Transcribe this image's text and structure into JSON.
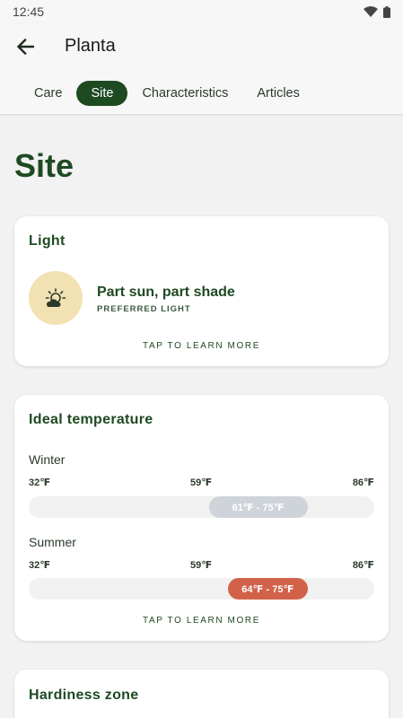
{
  "status_bar": {
    "time": "12:45"
  },
  "app_bar": {
    "title": "Planta"
  },
  "tabs": [
    {
      "label": "Care",
      "active": false
    },
    {
      "label": "Site",
      "active": true
    },
    {
      "label": "Characteristics",
      "active": false
    },
    {
      "label": "Articles",
      "active": false
    }
  ],
  "page": {
    "title": "Site"
  },
  "light_card": {
    "title": "Light",
    "value": "Part sun, part shade",
    "caption": "PREFERRED LIGHT",
    "icon": "sun-cloud-icon",
    "learn_more": "TAP TO LEARN MORE"
  },
  "temperature_card": {
    "title": "Ideal temperature",
    "seasons": [
      {
        "name": "Winter",
        "scale": [
          "32℉",
          "59℉",
          "86℉"
        ],
        "range_label": "61℉ - 75℉",
        "range": [
          61,
          75
        ],
        "color": "#cfd4da"
      },
      {
        "name": "Summer",
        "scale": [
          "32℉",
          "59℉",
          "86℉"
        ],
        "range_label": "64℉ - 75℉",
        "range": [
          64,
          75
        ],
        "color": "#d2614a"
      }
    ],
    "learn_more": "TAP TO LEARN MORE"
  },
  "hardiness_card": {
    "title": "Hardiness zone"
  },
  "colors": {
    "accent": "#1e4a22",
    "light_icon_bg": "#f2e2b3",
    "winter_pill": "#cfd4da",
    "summer_pill": "#d2614a"
  }
}
